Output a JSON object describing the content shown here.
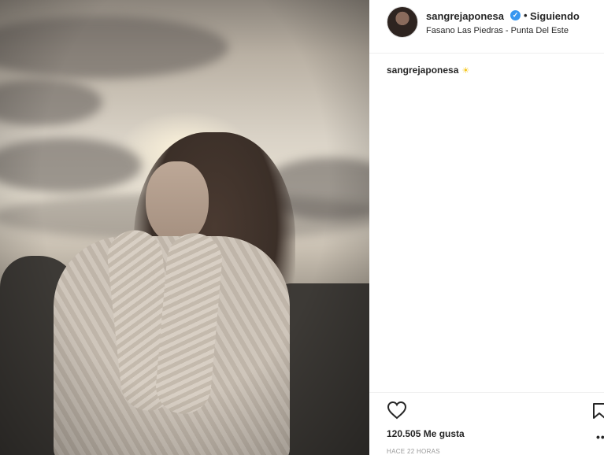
{
  "post": {
    "photo_description_icon": "portrait-photo",
    "username": "sangrejaponesa",
    "verified_icon": "verified-badge-icon",
    "separator": "•",
    "follow_status": "Siguiendo",
    "location": "Fasano Las Piedras - Punta Del Este",
    "caption": {
      "username": "sangrejaponesa",
      "emoji": "☀"
    },
    "likes": "120.505 Me gusta",
    "timestamp": "HACE 22 HORAS",
    "more_options": "•••"
  },
  "colors": {
    "verified": "#3897f0",
    "text": "#262626",
    "muted": "#999999"
  }
}
